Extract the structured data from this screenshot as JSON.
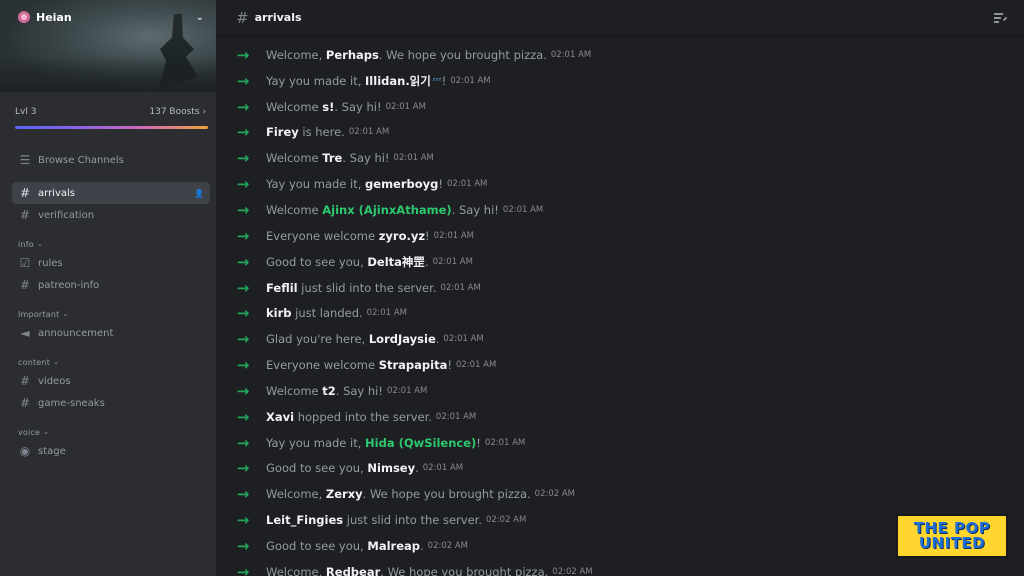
{
  "server": {
    "name": "Heian",
    "level": "Lvl 3",
    "boosts": "137 Boosts"
  },
  "sidebar": {
    "browse": "Browse Channels",
    "top_channels": [
      {
        "name": "arrivals",
        "icon": "hash-icon",
        "active": true
      },
      {
        "name": "verification",
        "icon": "hash-icon",
        "active": false
      }
    ],
    "categories": [
      {
        "name": "info",
        "channels": [
          {
            "name": "rules",
            "icon": "rules-icon"
          },
          {
            "name": "patreon-info",
            "icon": "hash-icon"
          }
        ]
      },
      {
        "name": "Important",
        "channels": [
          {
            "name": "announcement",
            "icon": "megaphone-icon"
          }
        ]
      },
      {
        "name": "content",
        "channels": [
          {
            "name": "videos",
            "icon": "hash-icon"
          },
          {
            "name": "game-sneaks",
            "icon": "hash-icon"
          }
        ]
      },
      {
        "name": "voice",
        "channels": [
          {
            "name": "stage",
            "icon": "stage-icon"
          }
        ]
      }
    ]
  },
  "channel": {
    "title": "arrivals"
  },
  "messages": [
    {
      "pre": "Welcome, ",
      "user": "Perhaps",
      "post": ". We hope you brought pizza.",
      "time": "02:01 AM"
    },
    {
      "pre": "Yay you made it, ",
      "user": "Illidan.읽기",
      "post": "!",
      "time": "02:01 AM",
      "zz": "ᶻᶻᶻ"
    },
    {
      "pre": "Welcome ",
      "user": "s!",
      "post": ". Say hi!",
      "time": "02:01 AM"
    },
    {
      "pre": "",
      "user": "Firey",
      "post": " is here.",
      "time": "02:01 AM"
    },
    {
      "pre": "Welcome ",
      "user": "Tre",
      "post": ". Say hi!",
      "time": "02:01 AM"
    },
    {
      "pre": "Yay you made it, ",
      "user": "gemerboyg",
      "post": "!",
      "time": "02:01 AM"
    },
    {
      "pre": "Welcome ",
      "user": "Ajinx (AjinxAthame)",
      "post": ". Say hi!",
      "time": "02:01 AM",
      "green": true
    },
    {
      "pre": "Everyone welcome ",
      "user": "zyro.yz",
      "post": "!",
      "time": "02:01 AM"
    },
    {
      "pre": "Good to see you, ",
      "user": "Delta神罡",
      "post": ".",
      "time": "02:01 AM"
    },
    {
      "pre": "",
      "user": "Feflil",
      "post": " just slid into the server.",
      "time": "02:01 AM"
    },
    {
      "pre": "",
      "user": "kirb",
      "post": " just landed.",
      "time": "02:01 AM"
    },
    {
      "pre": "Glad you're here, ",
      "user": "LordJaysie",
      "post": ".",
      "time": "02:01 AM"
    },
    {
      "pre": "Everyone welcome ",
      "user": "Strapapita",
      "post": "!",
      "time": "02:01 AM"
    },
    {
      "pre": "Welcome ",
      "user": "t2",
      "post": ". Say hi!",
      "time": "02:01 AM"
    },
    {
      "pre": "",
      "user": "Xavi",
      "post": " hopped into the server.",
      "time": "02:01 AM"
    },
    {
      "pre": "Yay you made it, ",
      "user": "Hida (QwSilence)",
      "post": "!",
      "time": "02:01 AM",
      "green": true
    },
    {
      "pre": "Good to see you, ",
      "user": "Nimsey",
      "post": ".",
      "time": "02:01 AM"
    },
    {
      "pre": "Welcome, ",
      "user": "Zerxy",
      "post": ". We hope you brought pizza.",
      "time": "02:02 AM"
    },
    {
      "pre": "",
      "user": "Leit_Fingies",
      "post": " just slid into the server.",
      "time": "02:02 AM"
    },
    {
      "pre": "Good to see you, ",
      "user": "Malreap",
      "post": ".",
      "time": "02:02 AM"
    },
    {
      "pre": "Welcome, ",
      "user": "Redbear",
      "post": ". We hope you brought pizza.",
      "time": "02:02 AM"
    }
  ],
  "watermark": {
    "line1": "THE POP",
    "line2": "UNITED"
  },
  "colors": {
    "accent_green": "#23a55a",
    "role_green": "#2dc770",
    "sidebar_bg": "#2b2d31",
    "main_bg": "#1e1f22"
  }
}
